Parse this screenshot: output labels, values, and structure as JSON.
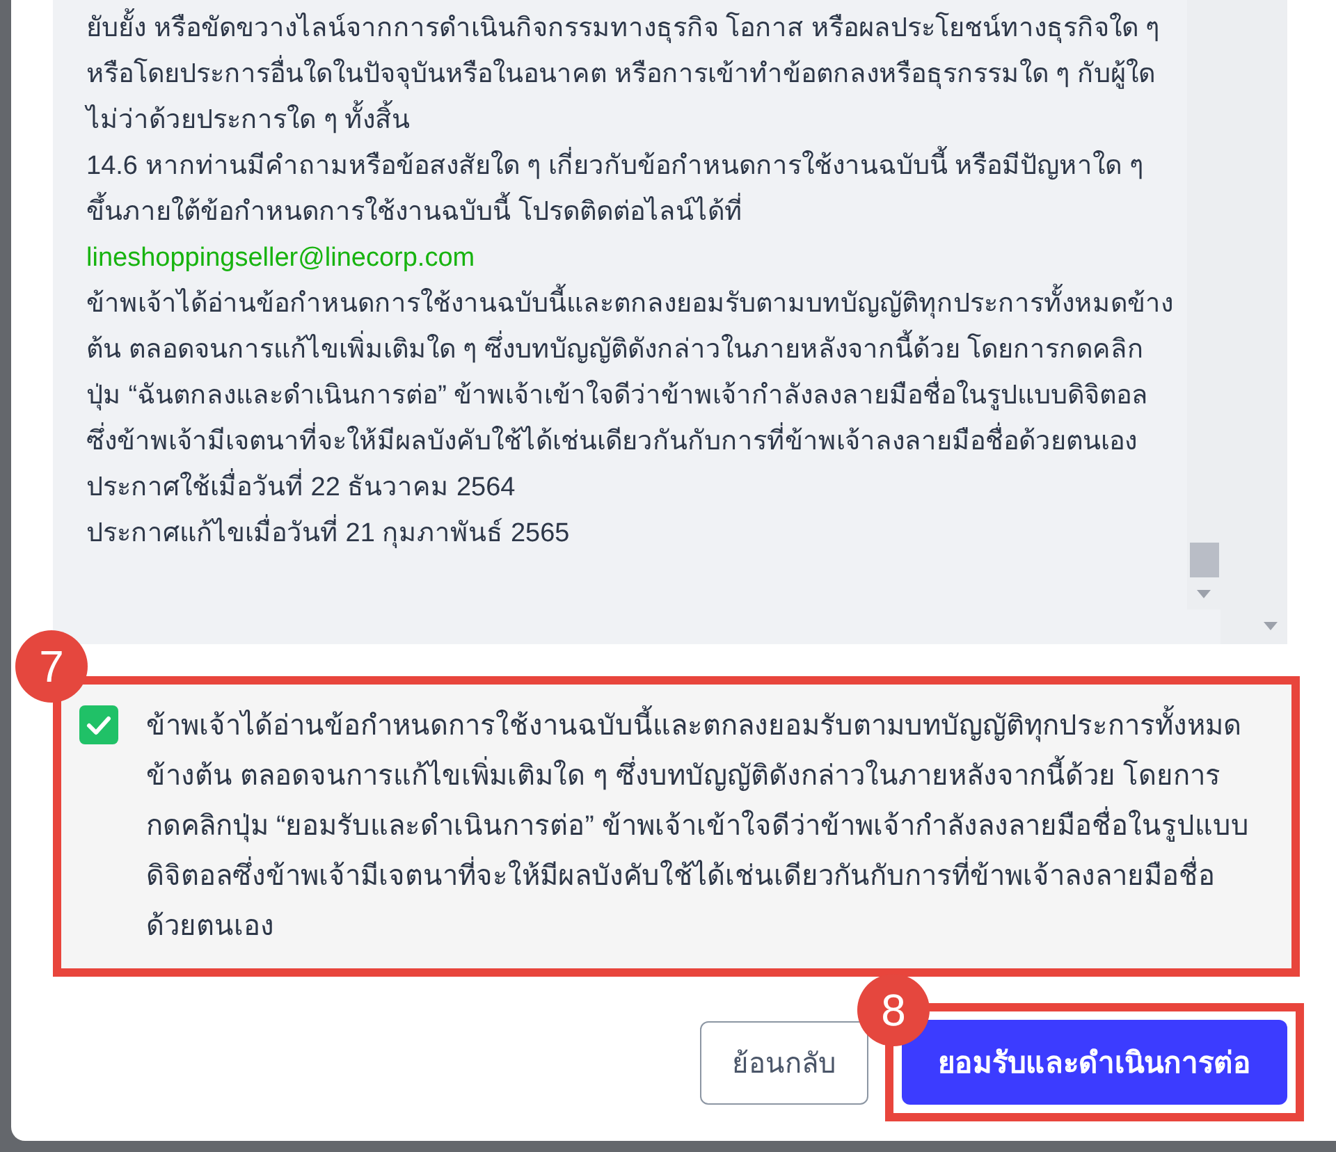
{
  "terms": {
    "paragraphs": [
      {
        "kind": "text",
        "text": "ยับยั้ง หรือขัดขวางไลน์จากการดำเนินกิจกรรมทางธุรกิจ โอกาส หรือผลประโยชน์ทางธุรกิจใด ๆ หรือโดยประการอื่นใดในปัจจุบันหรือในอนาคต หรือการเข้าทำข้อตกลงหรือธุรกรรมใด ๆ กับผู้ใดไม่ว่าด้วยประการใด ๆ ทั้งสิ้น"
      },
      {
        "kind": "text",
        "text": "14.6 หากท่านมีคำถามหรือข้อสงสัยใด ๆ เกี่ยวกับข้อกำหนดการใช้งานฉบับนี้ หรือมีปัญหาใด ๆ ขึ้นภายใต้ข้อกำหนดการใช้งานฉบับนี้ โปรดติดต่อไลน์ได้ที่"
      },
      {
        "kind": "link",
        "text": "lineshoppingseller@linecorp.com"
      },
      {
        "kind": "text",
        "text": "ข้าพเจ้าได้อ่านข้อกำหนดการใช้งานฉบับนี้และตกลงยอมรับตามบทบัญญัติทุกประการทั้งหมดข้างต้น ตลอดจนการแก้ไขเพิ่มเติมใด ๆ ซึ่งบทบัญญัติดังกล่าวในภายหลังจากนี้ด้วย โดยการกดคลิกปุ่ม “ฉันตกลงและดำเนินการต่อ” ข้าพเจ้าเข้าใจดีว่าข้าพเจ้ากำลังลงลายมือชื่อในรูปแบบดิจิตอลซึ่งข้าพเจ้ามีเจตนาที่จะให้มีผลบังคับใช้ได้เช่นเดียวกันกับการที่ข้าพเจ้าลงลายมือชื่อด้วยตนเอง"
      },
      {
        "kind": "text",
        "text": "ประกาศใช้เมื่อวันที่ 22 ธันวาคม 2564"
      },
      {
        "kind": "text",
        "text": "ประกาศแก้ไขเมื่อวันที่ 21 กุมภาพันธ์ 2565"
      }
    ]
  },
  "consent": {
    "checked": true,
    "text": "ข้าพเจ้าได้อ่านข้อกำหนดการใช้งานฉบับนี้และตกลงยอมรับตามบทบัญญัติทุกประการทั้งหมดข้างต้น ตลอดจนการแก้ไขเพิ่มเติมใด ๆ ซึ่งบทบัญญัติดังกล่าวในภายหลังจากนี้ด้วย โดยการกดคลิกปุ่ม “ยอมรับและดำเนินการต่อ” ข้าพเจ้าเข้าใจดีว่าข้าพเจ้ากำลังลงลายมือชื่อในรูปแบบดิจิตอลซึ่งข้าพเจ้ามีเจตนาที่จะให้มีผลบังคับใช้ได้เช่นเดียวกันกับการที่ข้าพเจ้าลงลายมือชื่อด้วยตนเอง",
    "callout": "7"
  },
  "buttons": [
    {
      "kind": "secondary",
      "label": "ย้อนกลับ"
    },
    {
      "kind": "primary",
      "label": "ยอมรับและดำเนินการต่อ",
      "callout": "8"
    }
  ]
}
